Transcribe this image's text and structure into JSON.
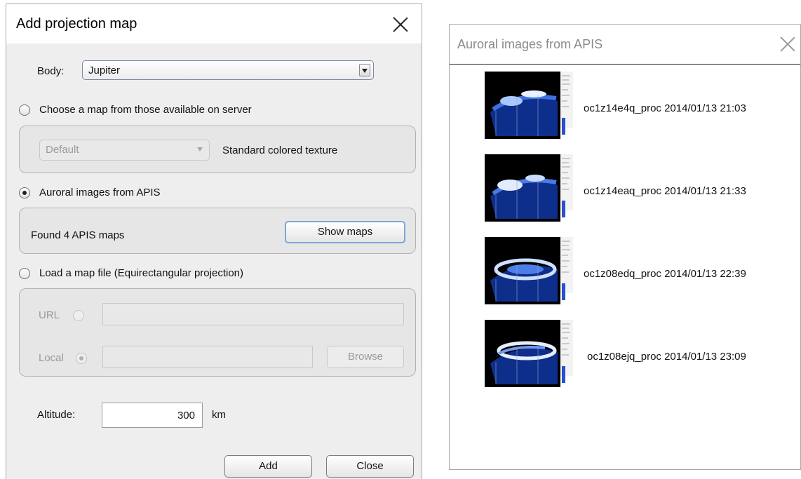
{
  "dialog": {
    "title": "Add projection map",
    "body_label": "Body:",
    "body_value": "Jupiter",
    "option_server_label": "Choose a map from those available on server",
    "server_map_value": "Default",
    "server_map_desc": "Standard colored texture",
    "option_apis_label": "Auroral images from APIS",
    "apis_found_text": "Found 4 APIS maps",
    "show_maps_label": "Show maps",
    "option_file_label": "Load a map file (Equirectangular projection)",
    "url_label": "URL",
    "local_label": "Local",
    "browse_label": "Browse",
    "altitude_label": "Altitude:",
    "altitude_value": "300",
    "altitude_unit": "km",
    "add_label": "Add",
    "close_label": "Close"
  },
  "apis_window": {
    "title": "Auroral images from APIS",
    "maps": [
      {
        "name": "oc1z14e4q_proc 2014/01/13 21:03"
      },
      {
        "name": "oc1z14eaq_proc 2014/01/13 21:33"
      },
      {
        "name": "oc1z08edq_proc 2014/01/13 22:39"
      },
      {
        "name": "oc1z08ejq_proc 2014/01/13 23:09"
      }
    ]
  }
}
